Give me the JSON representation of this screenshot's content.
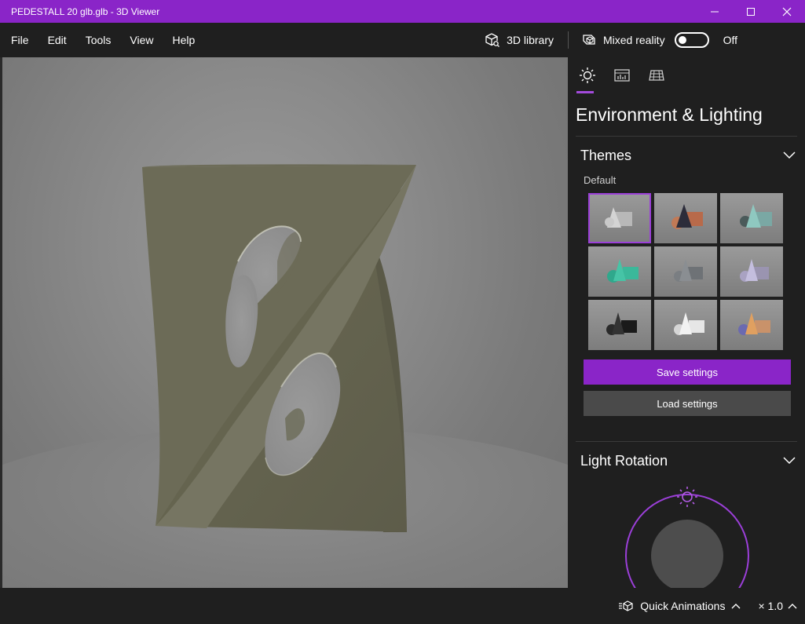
{
  "window": {
    "title": "PEDESTALL 20 glb.glb - 3D Viewer"
  },
  "menu": {
    "items": [
      "File",
      "Edit",
      "Tools",
      "View",
      "Help"
    ]
  },
  "toolbar": {
    "library_label": "3D library",
    "mixed_reality_label": "Mixed reality",
    "toggle_state": "Off"
  },
  "panel": {
    "title": "Environment & Lighting",
    "themes": {
      "heading": "Themes",
      "selected_label": "Default",
      "thumbnails": [
        {
          "name": "default",
          "selected": true
        },
        {
          "name": "dark-orange"
        },
        {
          "name": "teal"
        },
        {
          "name": "green"
        },
        {
          "name": "gray-blue"
        },
        {
          "name": "lavender"
        },
        {
          "name": "black"
        },
        {
          "name": "white"
        },
        {
          "name": "warm-orange"
        }
      ],
      "save_label": "Save settings",
      "load_label": "Load settings"
    },
    "light_rotation": {
      "heading": "Light Rotation"
    }
  },
  "statusbar": {
    "animations_label": "Quick Animations",
    "zoom_label": "× 1.0"
  },
  "colors": {
    "accent": "#8a25c8",
    "background": "#1f1f1f",
    "model": "#6b6a58"
  }
}
